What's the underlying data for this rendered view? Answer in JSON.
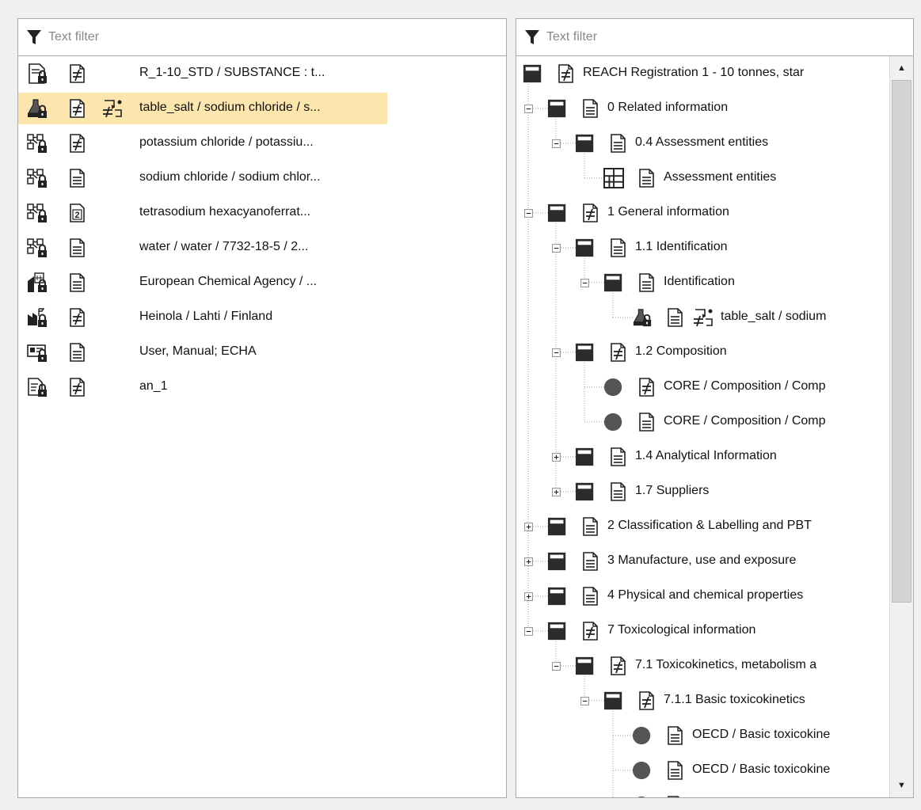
{
  "left": {
    "filter_placeholder": "Text filter",
    "rows": [
      {
        "text": "R_1-10_STD / SUBSTANCE : t...",
        "icon": "dossier-lock-icon",
        "doc": "doc-modified-icon",
        "extra": ""
      },
      {
        "text": "table_salt / sodium chloride / s...",
        "icon": "substance-lock-icon",
        "doc": "doc-modified-icon",
        "extra": "link-modified-icon"
      },
      {
        "text": "potassium chloride / potassiu...",
        "icon": "reference-substance-lock-icon",
        "doc": "doc-modified-icon",
        "extra": ""
      },
      {
        "text": "sodium chloride / sodium chlor...",
        "icon": "reference-substance-lock-icon",
        "doc": "doc-icon",
        "extra": ""
      },
      {
        "text": "tetrasodium hexacyanoferrat...",
        "icon": "reference-substance-lock-icon",
        "doc": "doc-version-icon",
        "extra": ""
      },
      {
        "text": "water / water / 7732-18-5 / 2...",
        "icon": "reference-substance-lock-icon",
        "doc": "doc-icon",
        "extra": ""
      },
      {
        "text": "European Chemical Agency / ...",
        "icon": "legal-entity-lock-icon",
        "doc": "doc-icon",
        "extra": ""
      },
      {
        "text": "Heinola / Lahti / Finland",
        "icon": "site-lock-icon",
        "doc": "doc-modified-icon",
        "extra": ""
      },
      {
        "text": "User, Manual; ECHA",
        "icon": "contact-lock-icon",
        "doc": "doc-icon",
        "extra": ""
      },
      {
        "text": "an_1",
        "icon": "annotation-lock-icon",
        "doc": "doc-modified-icon",
        "extra": ""
      }
    ],
    "doc_version_number": "2"
  },
  "right": {
    "filter_placeholder": "Text filter",
    "tree": [
      {
        "label": "REACH Registration 1 - 10 tonnes, star",
        "level": 0,
        "toggle": "none",
        "state": "square",
        "doc": "doc-modified-icon",
        "extra": ""
      },
      {
        "label": "0 Related information",
        "level": 1,
        "toggle": "minus",
        "state": "square",
        "doc": "doc-icon",
        "extra": ""
      },
      {
        "label": "0.4 Assessment entities",
        "level": 2,
        "toggle": "minus",
        "state": "square",
        "doc": "doc-icon",
        "extra": ""
      },
      {
        "label": "Assessment entities",
        "level": 3,
        "toggle": "none",
        "state": "grid",
        "doc": "doc-icon",
        "extra": ""
      },
      {
        "label": "1 General information",
        "level": 1,
        "toggle": "minus",
        "state": "square",
        "doc": "doc-modified-icon",
        "extra": ""
      },
      {
        "label": "1.1 Identification",
        "level": 2,
        "toggle": "minus",
        "state": "square",
        "doc": "doc-icon",
        "extra": ""
      },
      {
        "label": "Identification",
        "level": 3,
        "toggle": "minus",
        "state": "square",
        "doc": "doc-icon",
        "extra": ""
      },
      {
        "label": "table_salt / sodium",
        "level": 4,
        "toggle": "none",
        "state": "flask",
        "doc": "doc-icon",
        "extra": "link-modified-icon"
      },
      {
        "label": "1.2 Composition",
        "level": 2,
        "toggle": "minus",
        "state": "square",
        "doc": "doc-modified-icon",
        "extra": ""
      },
      {
        "label": "CORE / Composition / Comp",
        "level": 3,
        "toggle": "none",
        "state": "circle",
        "doc": "doc-modified-icon",
        "extra": ""
      },
      {
        "label": "CORE / Composition / Comp",
        "level": 3,
        "toggle": "none",
        "state": "circle",
        "doc": "doc-icon",
        "extra": ""
      },
      {
        "label": "1.4 Analytical Information",
        "level": 2,
        "toggle": "plus",
        "state": "square",
        "doc": "doc-icon",
        "extra": ""
      },
      {
        "label": "1.7 Suppliers",
        "level": 2,
        "toggle": "plus",
        "state": "square",
        "doc": "doc-icon",
        "extra": ""
      },
      {
        "label": "2 Classification & Labelling and PBT",
        "level": 1,
        "toggle": "plus",
        "state": "square",
        "doc": "doc-icon",
        "extra": ""
      },
      {
        "label": "3 Manufacture, use and exposure",
        "level": 1,
        "toggle": "plus",
        "state": "square",
        "doc": "doc-icon",
        "extra": ""
      },
      {
        "label": "4 Physical and chemical properties",
        "level": 1,
        "toggle": "plus",
        "state": "square",
        "doc": "doc-icon",
        "extra": ""
      },
      {
        "label": "7 Toxicological information",
        "level": 1,
        "toggle": "minus",
        "state": "square",
        "doc": "doc-modified-icon",
        "extra": ""
      },
      {
        "label": "7.1 Toxicokinetics, metabolism a",
        "level": 2,
        "toggle": "minus",
        "state": "square",
        "doc": "doc-modified-icon",
        "extra": ""
      },
      {
        "label": "7.1.1 Basic toxicokinetics",
        "level": 3,
        "toggle": "minus",
        "state": "square",
        "doc": "doc-modified-icon",
        "extra": ""
      },
      {
        "label": "OECD / Basic toxicokine",
        "level": 4,
        "toggle": "none",
        "state": "circle",
        "doc": "doc-icon",
        "extra": ""
      },
      {
        "label": "OECD / Basic toxicokine",
        "level": 4,
        "toggle": "none",
        "state": "circle",
        "doc": "doc-icon",
        "extra": ""
      },
      {
        "label": "",
        "level": 4,
        "toggle": "none",
        "state": "circle",
        "doc": "doc-icon",
        "extra": ""
      }
    ]
  },
  "colors": {
    "selection": "#fde6ae",
    "state_square": "#2b2b2b",
    "state_circle": "#555555",
    "border": "#a9a9a9"
  }
}
